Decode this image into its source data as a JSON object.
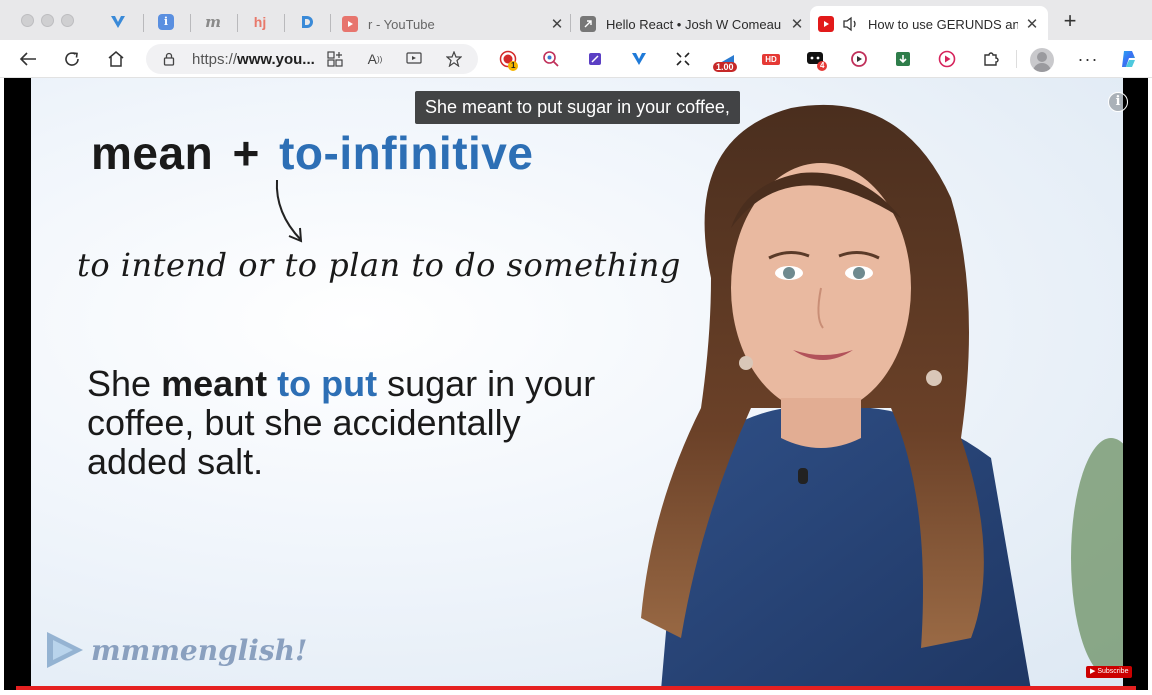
{
  "tabs": [
    {
      "title": "r - YouTube",
      "favicon": "youtube-icon",
      "active": false
    },
    {
      "title": "Hello React • Josh W Comeau",
      "favicon": "external-link-icon",
      "active": false
    },
    {
      "title": "How to use GERUNDS and",
      "favicon": "youtube-icon",
      "active": true,
      "audio": "speaker-icon"
    }
  ],
  "pinned_tabs": [
    "v-icon",
    "info-icon",
    "m-icon",
    "hj-icon",
    "d-icon"
  ],
  "toolbar": {
    "url_prefix": "https://",
    "url_domain": "www.you...",
    "extension_badges": {
      "first": "1",
      "speed": "1.00",
      "hd": "HD",
      "count": "4"
    }
  },
  "video": {
    "caption": "She meant to put sugar in your coffee,",
    "info_label": "i",
    "subscribe_label": "Subscribe",
    "slide": {
      "title_part1": "mean",
      "title_plus": "+",
      "title_part2": "to-infinitive",
      "definition": "to intend or to plan to do something",
      "example_she": "She",
      "example_meant": "meant",
      "example_to_put": "to put",
      "example_rest": "sugar in your coffee, but she accidentally added salt.",
      "logo": "mmmenglish!"
    }
  },
  "colors": {
    "accent_blue": "#2d6fb5",
    "youtube_red": "#e52020",
    "tabstrip_bg": "#e8e8ea"
  }
}
